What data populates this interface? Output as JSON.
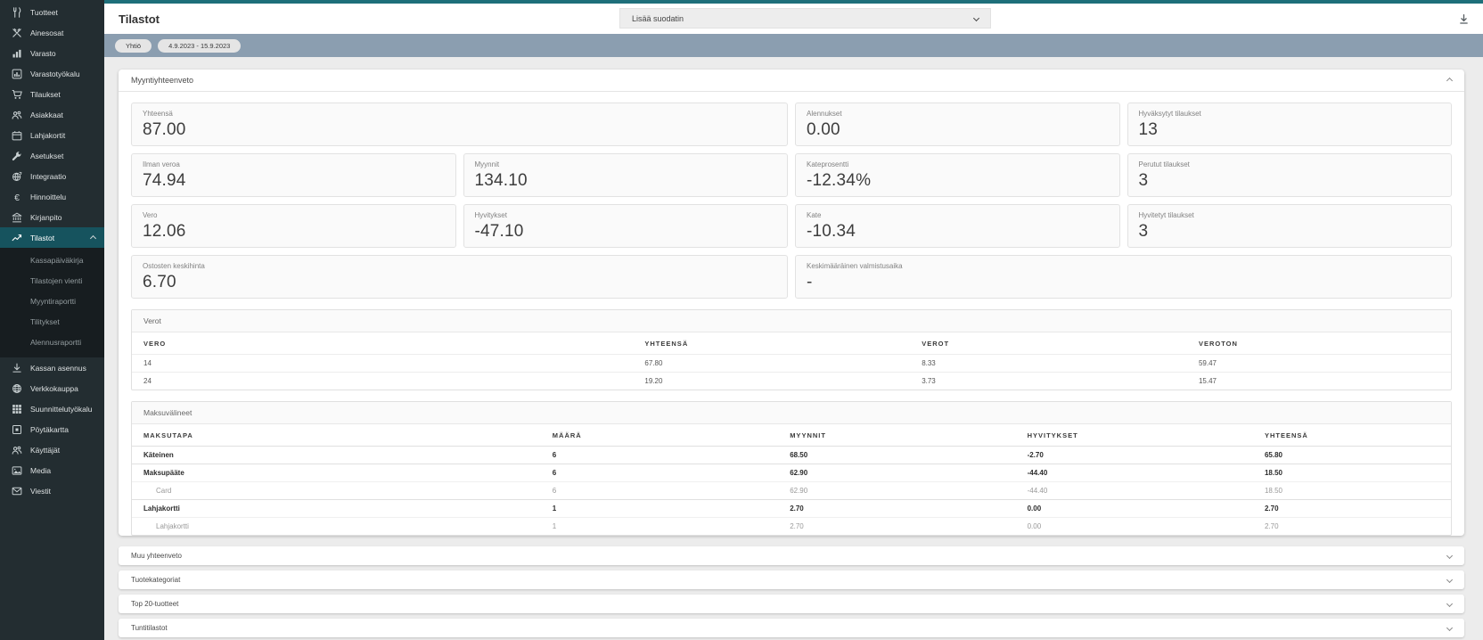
{
  "colors": {
    "accent_teal": "#1e6f7a",
    "sidebar_bg": "#232d31",
    "sidebar_submenu_bg": "#171d20",
    "sidebar_active_bg": "#16535e",
    "filter_bar_bg": "#8b9eb0",
    "content_bg": "#ececec",
    "card_bg": "#fafafa"
  },
  "sidebar": {
    "items": [
      {
        "label": "Tuotteet",
        "icon": "utensils-icon"
      },
      {
        "label": "Ainesosat",
        "icon": "crossed-utensils-icon"
      },
      {
        "label": "Varasto",
        "icon": "bar-chart-icon"
      },
      {
        "label": "Varastotyökalu",
        "icon": "chart-box-icon"
      },
      {
        "label": "Tilaukset",
        "icon": "cart-icon"
      },
      {
        "label": "Asiakkaat",
        "icon": "users-icon"
      },
      {
        "label": "Lahjakortit",
        "icon": "gift-card-icon"
      },
      {
        "label": "Asetukset",
        "icon": "wrench-icon"
      },
      {
        "label": "Integraatio",
        "icon": "globe-sync-icon"
      },
      {
        "label": "Hinnoittelu",
        "icon": "euro-icon"
      },
      {
        "label": "Kirjanpito",
        "icon": "bank-icon"
      },
      {
        "label": "Tilastot",
        "icon": "trend-icon",
        "active": true
      }
    ],
    "subitems": [
      {
        "label": "Kassapäiväkirja"
      },
      {
        "label": "Tilastojen vienti"
      },
      {
        "label": "Myyntiraportti"
      },
      {
        "label": "Tilitykset"
      },
      {
        "label": "Alennusraportti"
      }
    ],
    "items_bottom": [
      {
        "label": "Kassan asennus",
        "icon": "download-icon"
      },
      {
        "label": "Verkkokauppa",
        "icon": "globe-icon"
      },
      {
        "label": "Suunnittelutyökalu",
        "icon": "grid-icon"
      },
      {
        "label": "Pöytäkartta",
        "icon": "table-map-icon"
      },
      {
        "label": "Käyttäjät",
        "icon": "users-icon"
      },
      {
        "label": "Media",
        "icon": "media-icon"
      },
      {
        "label": "Viestit",
        "icon": "mail-icon"
      }
    ]
  },
  "header": {
    "title": "Tilastot",
    "filter_dropdown": "Lisää suodatin",
    "download_icon": "download-icon"
  },
  "filters": {
    "chips": [
      "Yhtiö",
      "4.9.2023 - 15.9.2023"
    ]
  },
  "sales_summary": {
    "title": "Myyntiyhteenveto",
    "cards": [
      {
        "label": "Yhteensä",
        "value": "87.00"
      },
      {
        "label": "Alennukset",
        "value": "0.00"
      },
      {
        "label": "Hyväksytyt tilaukset",
        "value": "13"
      },
      {
        "label": "Ilman veroa",
        "value": "74.94"
      },
      {
        "label": "Myynnit",
        "value": "134.10"
      },
      {
        "label": "Kateprosentti",
        "value": "-12.34%"
      },
      {
        "label": "Perutut tilaukset",
        "value": "3"
      },
      {
        "label": "Vero",
        "value": "12.06"
      },
      {
        "label": "Hyvitykset",
        "value": "-47.10"
      },
      {
        "label": "Kate",
        "value": "-10.34"
      },
      {
        "label": "Hyvitetyt tilaukset",
        "value": "3"
      },
      {
        "label": "Ostosten keskihinta",
        "value": "6.70"
      },
      {
        "label": "Keskimääräinen valmistusaika",
        "value": "-"
      }
    ]
  },
  "taxes": {
    "title": "Verot",
    "columns": [
      "VERO",
      "YHTEENSÄ",
      "VEROT",
      "VEROTON"
    ],
    "rows": [
      [
        "14",
        "67.80",
        "8.33",
        "59.47"
      ],
      [
        "24",
        "19.20",
        "3.73",
        "15.47"
      ]
    ]
  },
  "payments": {
    "title": "Maksuvälineet",
    "columns": [
      "MAKSUTAPA",
      "MÄÄRÄ",
      "MYYNNIT",
      "HYVITYKSET",
      "YHTEENSÄ"
    ],
    "rows": [
      {
        "name": "Käteinen",
        "level": 0,
        "maara": "6",
        "myynnit": "68.50",
        "hyvitykset": "-2.70",
        "yhteensa": "65.80"
      },
      {
        "name": "Maksupääte",
        "level": 0,
        "maara": "6",
        "myynnit": "62.90",
        "hyvitykset": "-44.40",
        "yhteensa": "18.50"
      },
      {
        "name": "Card",
        "level": 1,
        "maara": "6",
        "myynnit": "62.90",
        "hyvitykset": "-44.40",
        "yhteensa": "18.50"
      },
      {
        "name": "Lahjakortti",
        "level": 0,
        "maara": "1",
        "myynnit": "2.70",
        "hyvitykset": "0.00",
        "yhteensa": "2.70"
      },
      {
        "name": "Lahjakortti",
        "level": 1,
        "maara": "1",
        "myynnit": "2.70",
        "hyvitykset": "0.00",
        "yhteensa": "2.70"
      }
    ]
  },
  "collapsed_sections": [
    "Muu yhteenveto",
    "Tuotekategoriat",
    "Top 20-tuotteet",
    "Tuntitilastot"
  ]
}
